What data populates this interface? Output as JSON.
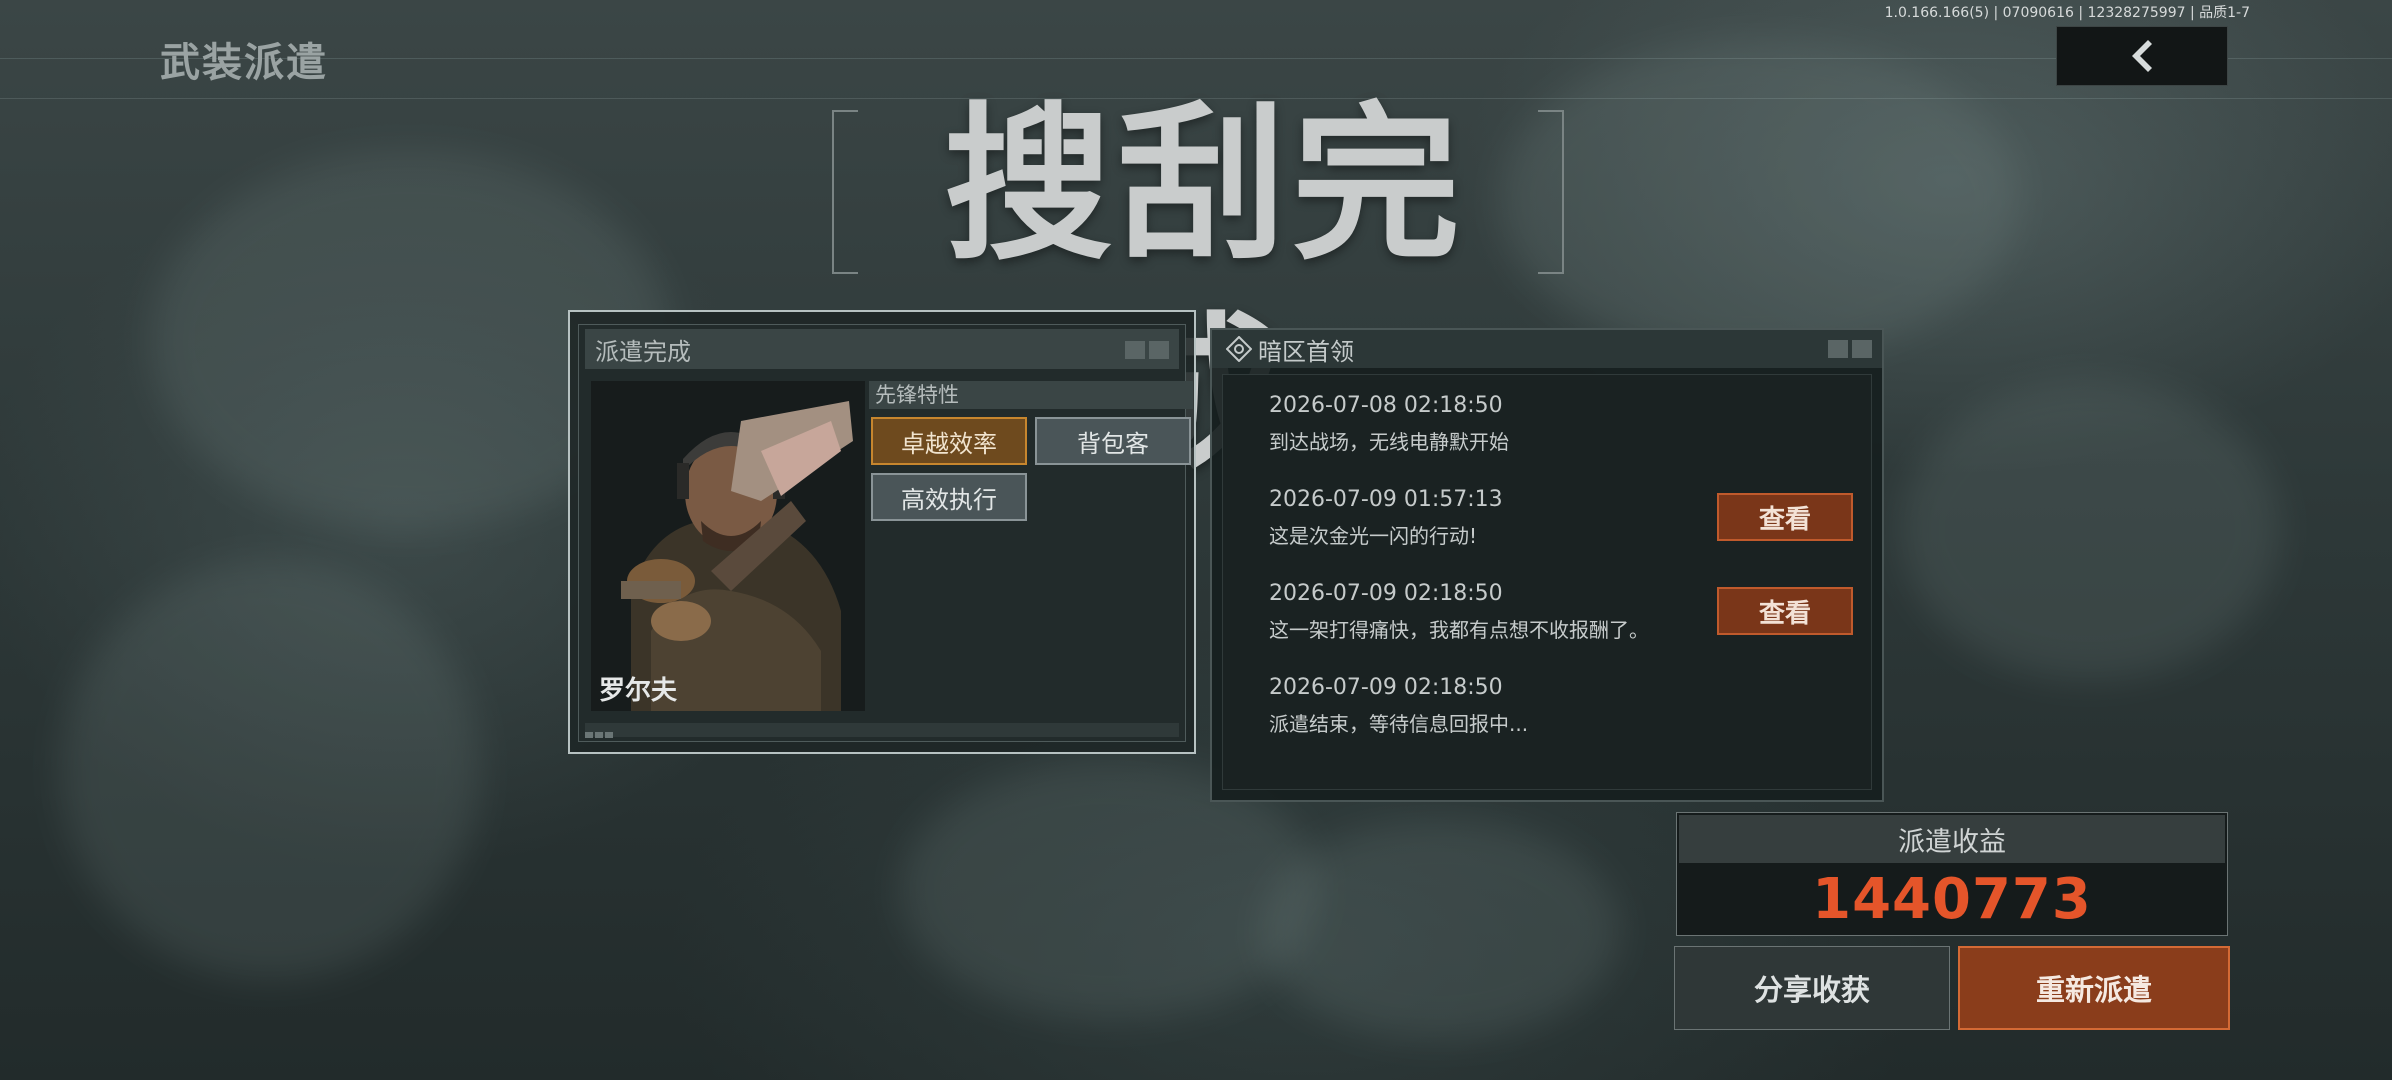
{
  "header": {
    "version_info": "1.0.166.166(5) | 07090616 | 12328275997 | 品质1-7",
    "page_title": "武装派遣",
    "back_icon": "chevron-left-icon"
  },
  "hero": {
    "title": "搜刮完成"
  },
  "dispatch_panel": {
    "title": "派遣完成",
    "operator_name": "罗尔夫",
    "trait_header": "先锋特性",
    "traits": [
      {
        "label": "卓越效率",
        "style": "gold"
      },
      {
        "label": "背包客",
        "style": "grey"
      },
      {
        "label": "高效执行",
        "style": "grey"
      }
    ]
  },
  "log_panel": {
    "title": "暗区首领",
    "icon": "target-diamond-icon",
    "entries": [
      {
        "time": "2026-07-08 02:18:50",
        "text": "到达战场，无线电静默开始",
        "button": ""
      },
      {
        "time": "2026-07-09 01:57:13",
        "text": "这是次金光一闪的行动!",
        "button": "查看"
      },
      {
        "time": "2026-07-09 02:18:50",
        "text": "这一架打得痛快，我都有点想不收报酬了。",
        "button": "查看"
      },
      {
        "time": "2026-07-09 02:18:50",
        "text": "派遣结束，等待信息回报中...",
        "button": ""
      }
    ]
  },
  "earnings": {
    "label": "派遣收益",
    "value": "1440773"
  },
  "actions": {
    "share_label": "分享收获",
    "redeploy_label": "重新派遣"
  },
  "colors": {
    "accent_orange": "#e5552a",
    "button_rust": "#8a3d1b",
    "trait_gold": "#c7862e"
  }
}
